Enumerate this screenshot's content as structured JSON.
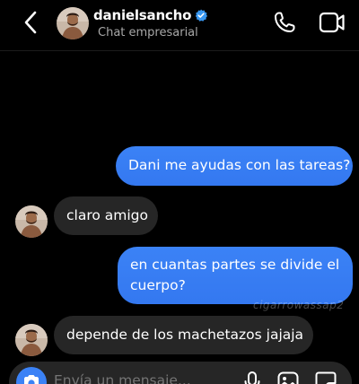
{
  "header": {
    "username": "danielsancho",
    "subtitle": "Chat empresarial",
    "verified": true
  },
  "messages": [
    {
      "direction": "outgoing",
      "text": "Dani me ayudas con las tareas?"
    },
    {
      "direction": "incoming",
      "text": "claro amigo"
    },
    {
      "direction": "outgoing",
      "text": "en cuantas partes se divide el cuerpo?"
    },
    {
      "direction": "incoming",
      "text": "depende de los machetazos jajaja"
    }
  ],
  "watermark": "cigarrowassap2",
  "composer": {
    "placeholder": "Envía un mensaje..."
  },
  "colors": {
    "background": "#000000",
    "outgoing_bubble": "#3b82f6",
    "incoming_bubble": "#262626",
    "verified_badge": "#3897f0"
  },
  "icons": {
    "back": "chevron-left-icon",
    "verified": "verified-badge-icon",
    "call": "phone-icon",
    "video": "video-camera-icon",
    "camera": "camera-icon",
    "mic": "microphone-icon",
    "gallery": "image-icon",
    "sticker": "sticker-icon"
  }
}
